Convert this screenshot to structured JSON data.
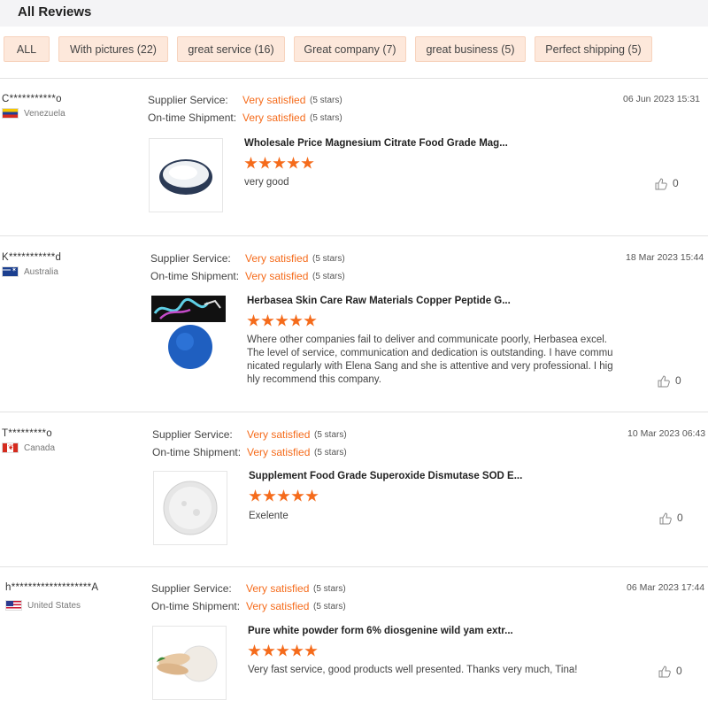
{
  "title": "All Reviews",
  "filters": [
    {
      "label": "ALL"
    },
    {
      "label": "With pictures (22)"
    },
    {
      "label": "great service (16)"
    },
    {
      "label": "Great company (7)"
    },
    {
      "label": "great business (5)"
    },
    {
      "label": "Perfect shipping (5)"
    }
  ],
  "reviews": [
    {
      "user": "C***********o",
      "country": "Venezuela",
      "date": "06 Jun 2023 15:31",
      "supplier_label": "Supplier Service:",
      "supplier_value": "Very satisfied",
      "supplier_stars": "(5 stars)",
      "shipment_label": "On-time Shipment:",
      "shipment_value": "Very satisfied",
      "shipment_stars": "(5 stars)",
      "product": "Wholesale Price Magnesium Citrate Food Grade Mag...",
      "rating": 5,
      "comment": "very good",
      "likes": "0"
    },
    {
      "user": "K***********d",
      "country": "Australia",
      "date": "18 Mar 2023 15:44",
      "supplier_label": "Supplier Service:",
      "supplier_value": "Very satisfied",
      "supplier_stars": "(5 stars)",
      "shipment_label": "On-time Shipment:",
      "shipment_value": "Very satisfied",
      "shipment_stars": "(5 stars)",
      "product": "Herbasea Skin Care Raw Materials Copper Peptide G...",
      "rating": 5,
      "comment": "Where other companies fail to deliver and communicate poorly, Herbasea excel. The level of service, communication and dedication is outstanding. I have communicated regularly with Elena Sang and she is attentive and very professional. I highly recommend this company.",
      "likes": "0"
    },
    {
      "user": "T*********o",
      "country": "Canada",
      "date": "10 Mar 2023 06:43",
      "supplier_label": "Supplier Service:",
      "supplier_value": "Very satisfied",
      "supplier_stars": "(5 stars)",
      "shipment_label": "On-time Shipment:",
      "shipment_value": "Very satisfied",
      "shipment_stars": "(5 stars)",
      "product": "Supplement Food Grade Superoxide Dismutase SOD E...",
      "rating": 5,
      "comment": "Exelente",
      "likes": "0"
    },
    {
      "user": "h*******************A",
      "country": "United States",
      "date": "06 Mar 2023 17:44",
      "supplier_label": "Supplier Service:",
      "supplier_value": "Very satisfied",
      "supplier_stars": "(5 stars)",
      "shipment_label": "On-time Shipment:",
      "shipment_value": "Very satisfied",
      "shipment_stars": "(5 stars)",
      "product": "Pure white powder form 6% diosgenine wild yam extr...",
      "rating": 5,
      "comment": "Very fast service, good products well presented. Thanks very much, Tina!",
      "likes": "0"
    }
  ],
  "colors": {
    "accent": "#f56b1b",
    "chip_bg": "#fde8db",
    "header_bg": "#f4f4f6"
  }
}
